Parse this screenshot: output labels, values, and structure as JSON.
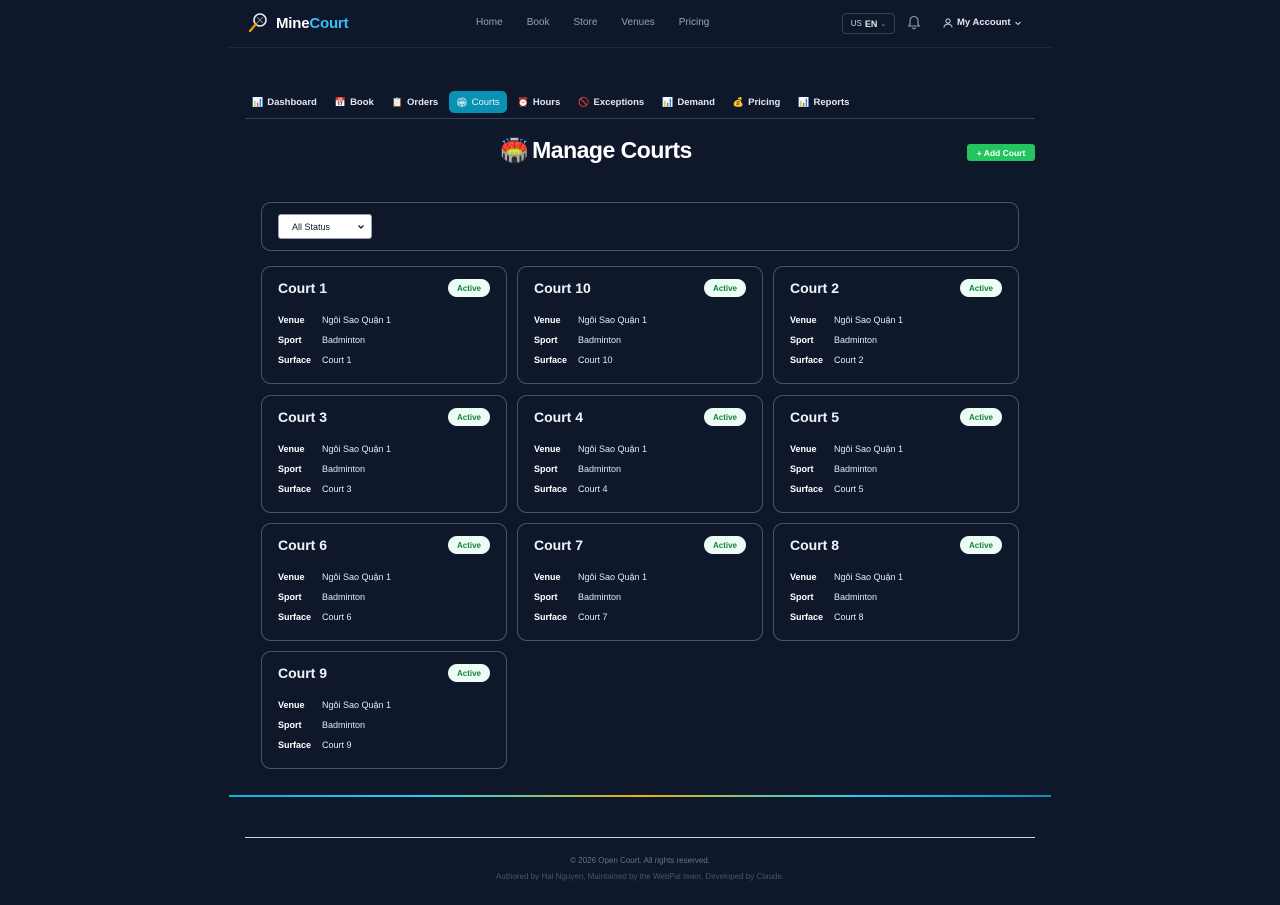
{
  "brand": {
    "name_part1": "Mine",
    "name_part2": "Court"
  },
  "nav": [
    "Home",
    "Book",
    "Store",
    "Venues",
    "Pricing"
  ],
  "language": {
    "flag": "US",
    "code": "EN"
  },
  "account": {
    "label": "My Account"
  },
  "tabs": [
    {
      "label": "Dashboard",
      "icon": "📊"
    },
    {
      "label": "Book",
      "icon": "📅"
    },
    {
      "label": "Orders",
      "icon": "📋"
    },
    {
      "label": "Courts",
      "icon": "🏟",
      "active": true
    },
    {
      "label": "Hours",
      "icon": "⏰"
    },
    {
      "label": "Exceptions",
      "icon": "🚫"
    },
    {
      "label": "Demand",
      "icon": "📊"
    },
    {
      "label": "Pricing",
      "icon": "💰"
    },
    {
      "label": "Reports",
      "icon": "📊"
    }
  ],
  "page": {
    "title_icon": "🏟️",
    "title": "Manage Courts",
    "add_button": "+ Add Court"
  },
  "filter": {
    "status_value": "All Status"
  },
  "labels": {
    "venue": "Venue",
    "sport": "Sport",
    "surface": "Surface"
  },
  "courts": [
    {
      "name": "Court 1",
      "status": "Active",
      "venue": "Ngôi Sao Quận 1",
      "sport": "Badminton",
      "surface": "Court 1"
    },
    {
      "name": "Court 10",
      "status": "Active",
      "venue": "Ngôi Sao Quận 1",
      "sport": "Badminton",
      "surface": "Court 10"
    },
    {
      "name": "Court 2",
      "status": "Active",
      "venue": "Ngôi Sao Quận 1",
      "sport": "Badminton",
      "surface": "Court 2"
    },
    {
      "name": "Court 3",
      "status": "Active",
      "venue": "Ngôi Sao Quận 1",
      "sport": "Badminton",
      "surface": "Court 3"
    },
    {
      "name": "Court 4",
      "status": "Active",
      "venue": "Ngôi Sao Quận 1",
      "sport": "Badminton",
      "surface": "Court 4"
    },
    {
      "name": "Court 5",
      "status": "Active",
      "venue": "Ngôi Sao Quận 1",
      "sport": "Badminton",
      "surface": "Court 5"
    },
    {
      "name": "Court 6",
      "status": "Active",
      "venue": "Ngôi Sao Quận 1",
      "sport": "Badminton",
      "surface": "Court 6"
    },
    {
      "name": "Court 7",
      "status": "Active",
      "venue": "Ngôi Sao Quận 1",
      "sport": "Badminton",
      "surface": "Court 7"
    },
    {
      "name": "Court 8",
      "status": "Active",
      "venue": "Ngôi Sao Quận 1",
      "sport": "Badminton",
      "surface": "Court 8"
    },
    {
      "name": "Court 9",
      "status": "Active",
      "venue": "Ngôi Sao Quận 1",
      "sport": "Badminton",
      "surface": "Court 9"
    }
  ],
  "footer": {
    "copyright": "© 2026 Open Court. All rights reserved.",
    "credit": "Authored by Hai Nguyen, Maintained by the WebPal team, Developed by Claude."
  },
  "colors": {
    "background": "#0f172a",
    "accent": "#0891b2",
    "brand_accent": "#38bdf8",
    "add_button": "#22c55e",
    "badge_text": "#15803d"
  }
}
